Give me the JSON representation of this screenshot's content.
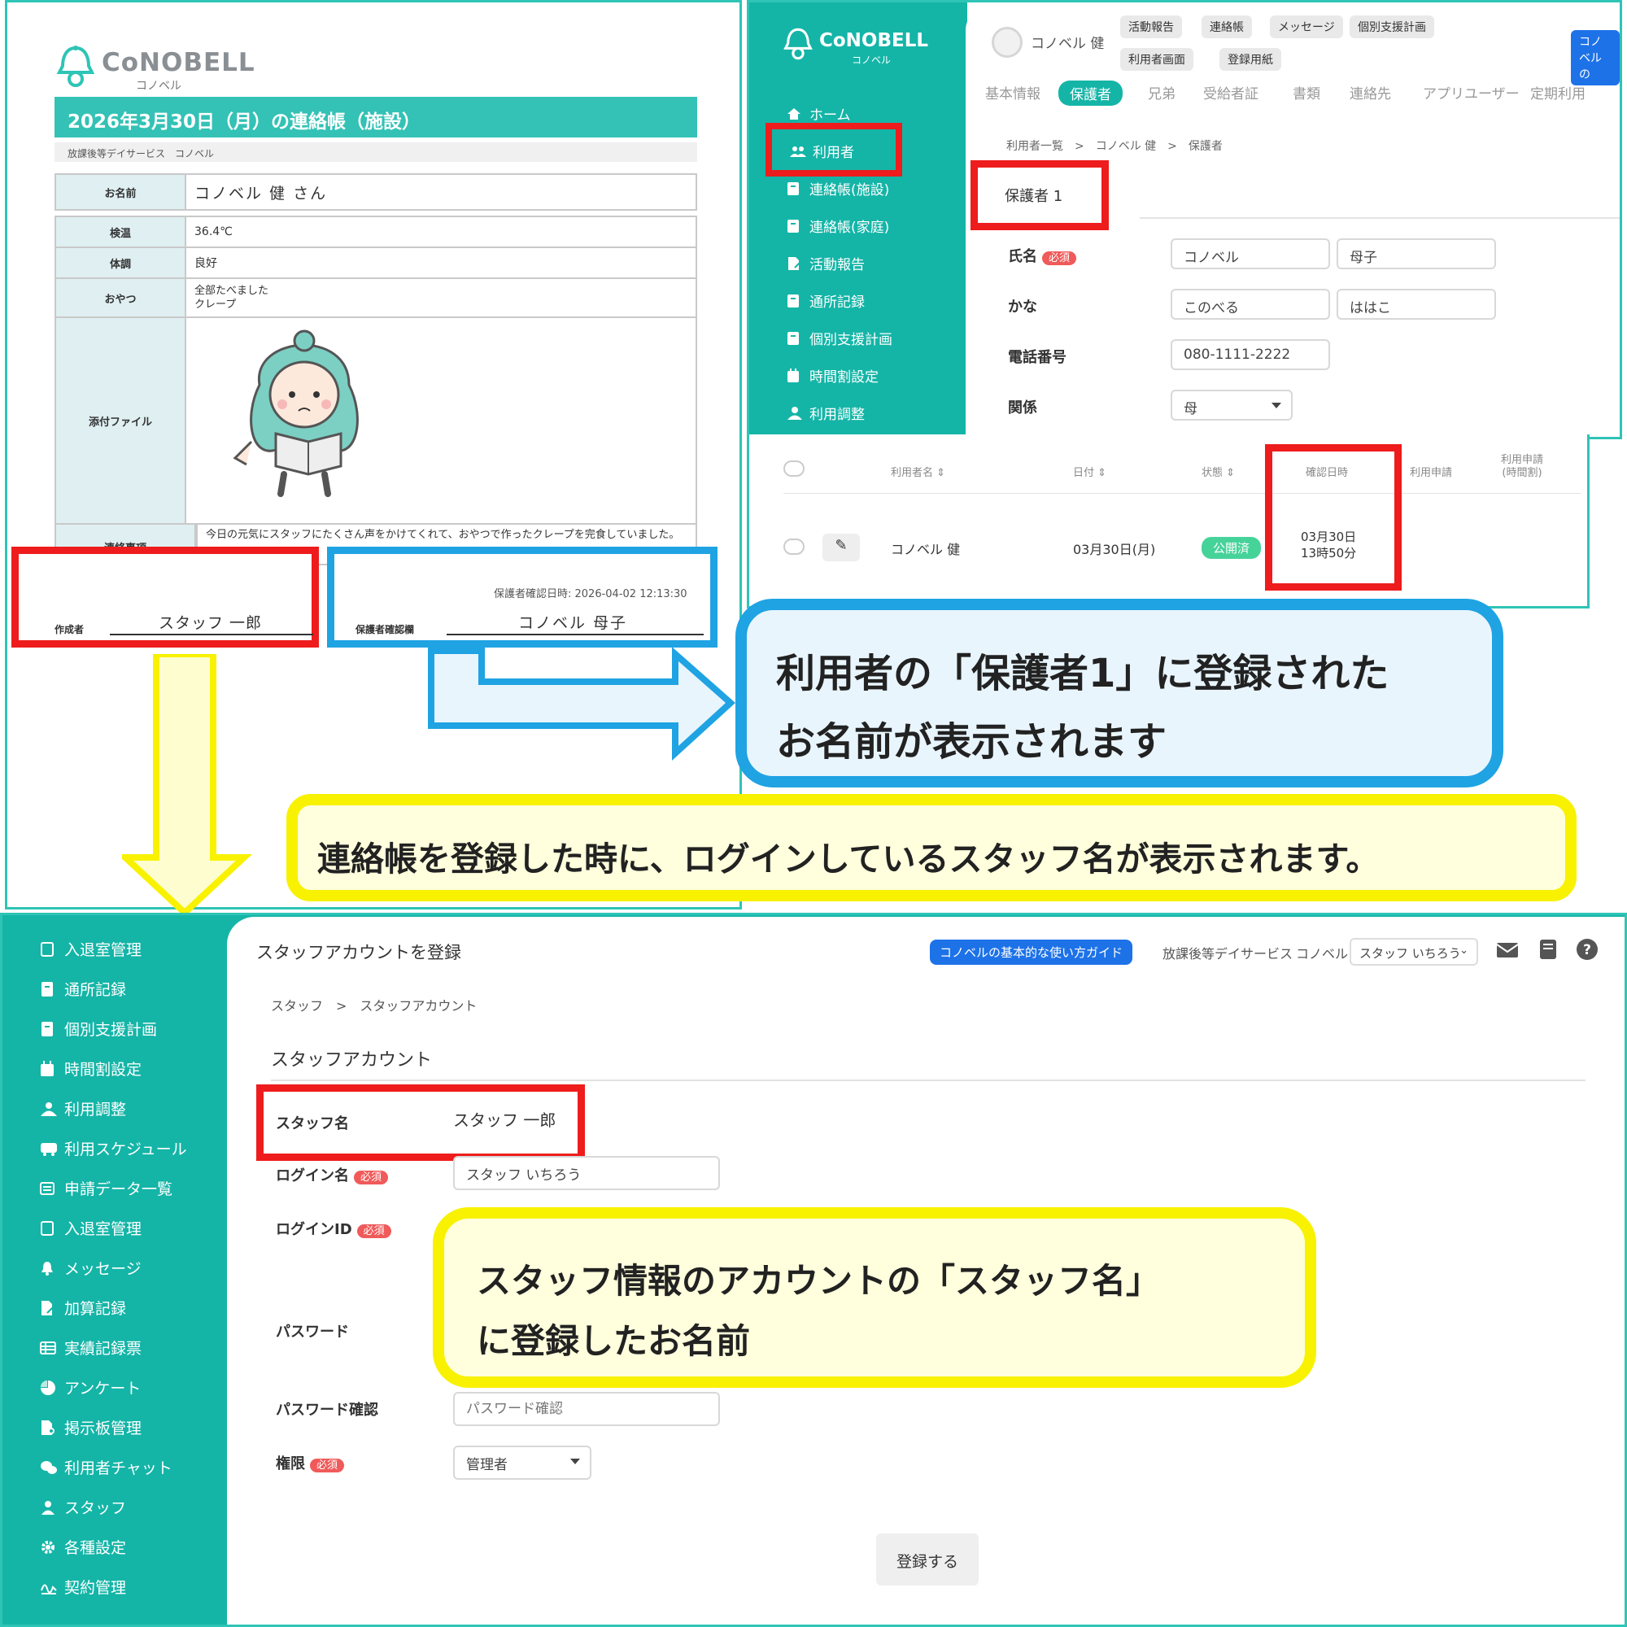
{
  "doc": {
    "logo": "CoNOBELL",
    "logo_sub": "コノベル",
    "title": "2026年3月30日（月）の連絡帳（施設）",
    "facility": "放課後等デイサービス　コノベル",
    "name_label": "お名前",
    "name_value": "コノベル 健 さん",
    "rows": [
      {
        "label": "検温",
        "value": "36.4℃"
      },
      {
        "label": "体調",
        "value": "良好"
      },
      {
        "label": "おやつ",
        "value": "全部たべました\nクレープ"
      }
    ],
    "attachment_label": "添付ファイル",
    "note_label": "連絡事項",
    "note_text": "今日の元気にスタッフにたくさん声をかけてくれて、おやつで作ったクレープを完食していました。",
    "author_label": "作成者",
    "author_value": "スタッフ 一郎",
    "guardian_date": "保護者確認日時: 2026-04-02 12:13:30",
    "guardian_label": "保護者確認欄",
    "guardian_value": "コノベル 母子"
  },
  "user_screen": {
    "logo": "CoNOBELL",
    "logo_sub": "コノベル",
    "sidebar": [
      "ホーム",
      "利用者",
      "連絡帳(施設)",
      "連絡帳(家庭)",
      "活動報告",
      "通所記録",
      "個別支援計画",
      "時間割設定",
      "利用調整"
    ],
    "user_name": "コノベル 健",
    "pills": [
      "活動報告",
      "連絡帳",
      "メッセージ",
      "個別支援計画",
      "利用者画面",
      "登録用紙"
    ],
    "guide": "コノベルの",
    "tabs": [
      "基本情報",
      "保護者",
      "兄弟",
      "受給者証",
      "書類",
      "連絡先",
      "アプリユーザー",
      "定期利用"
    ],
    "breadcrumb": "利用者一覧　>　コノベル 健　>　保護者",
    "section": "保護者 1",
    "fields": {
      "name_label": "氏名",
      "required": "必須",
      "last_name": "コノベル",
      "first_name": "母子",
      "kana_label": "かな",
      "kana_last": "このべる",
      "kana_first": "ははこ",
      "phone_label": "電話番号",
      "phone": "080-1111-2222",
      "relation_label": "関係",
      "relation": "母"
    }
  },
  "list": {
    "headers": [
      "利用者名 ⇕",
      "日付 ⇕",
      "状態 ⇕",
      "確認日時",
      "利用申請",
      "利用申請\n(時間割)"
    ],
    "row": {
      "name": "コノベル 健",
      "date": "03月30日(月)",
      "status": "公開済",
      "confirmed": "03月30日\n13時50分"
    }
  },
  "callouts": {
    "blue": "利用者の「保護者1」に登録された\nお名前が表示されます",
    "yellow1": "連絡帳を登録した時に、ログインしているスタッフ名が表示されます。",
    "yellow2": "スタッフ情報のアカウントの「スタッフ名」\nに登録したお名前"
  },
  "staff_screen": {
    "sidebar": [
      "入退室管理",
      "通所記録",
      "個別支援計画",
      "時間割設定",
      "利用調整",
      "利用スケジュール",
      "申請データ一覧",
      "入退室管理",
      "メッセージ",
      "加算記録",
      "実績記録票",
      "アンケート",
      "掲示板管理",
      "利用者チャット",
      "スタッフ",
      "各種設定",
      "契約管理"
    ],
    "title": "スタッフアカウントを登録",
    "guide": "コノベルの基本的な使い方ガイド",
    "facility": "放課後等デイサービス",
    "facility_name": "コノベル",
    "user_dropdown": "スタッフ いちろう",
    "breadcrumb": "スタッフ　>　スタッフアカウント",
    "section": "スタッフアカウント",
    "staff_name_label": "スタッフ名",
    "staff_name_value": "スタッフ 一郎",
    "login_name_label": "ログイン名",
    "login_name_value": "スタッフ いちろう",
    "login_id_label": "ログインID",
    "required": "必須",
    "password_label": "パスワード",
    "password_confirm_label": "パスワード確認",
    "password_confirm_placeholder": "パスワード確認",
    "role_label": "権限",
    "role_value": "管理者",
    "save_button": "登録する"
  },
  "colors": {
    "teal": "#14b5a7",
    "red_highlight": "#ee1c1c",
    "blue_highlight": "#1fa3e3",
    "yellow_highlight": "#f8f100"
  }
}
